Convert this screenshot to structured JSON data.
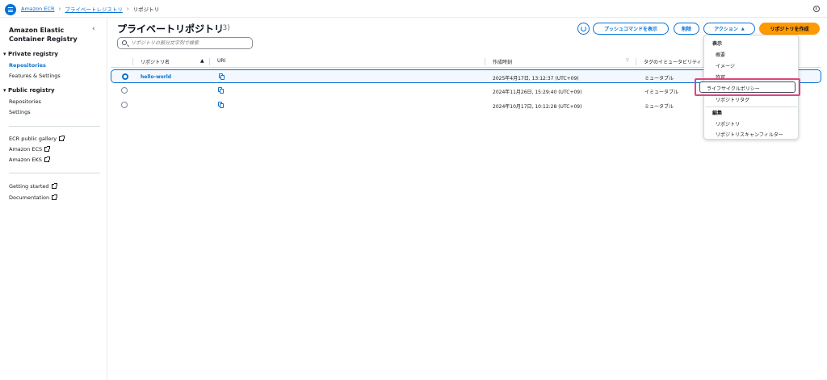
{
  "breadcrumb": {
    "root": "Amazon ECR",
    "parent": "プライベートレジストリ",
    "current": "リポジトリ"
  },
  "sidebar": {
    "title": "Amazon Elastic Container Registry",
    "private_section": "Private registry",
    "private_items": [
      "Repositories",
      "Features & Settings"
    ],
    "public_section": "Public registry",
    "public_items": [
      "Repositories",
      "Settings"
    ],
    "links": [
      "ECR public gallery",
      "Amazon ECS",
      "Amazon EKS"
    ],
    "help_links": [
      "Getting started",
      "Documentation"
    ]
  },
  "main": {
    "title": "プライベートリポジトリ",
    "count": "(3)",
    "search_placeholder": "リポジトリの部分文字列で検索"
  },
  "toolbar": {
    "push_label": "プッシュコマンドを表示",
    "delete_label": "削除",
    "action_label": "アクション",
    "create_label": "リポジトリを作成"
  },
  "table": {
    "columns": [
      "リポジトリ名",
      "URI",
      "作成時刻",
      "タグのイミュータビリティ"
    ],
    "rows": [
      {
        "name": "hello-world",
        "created": "2025年4月17日, 13:12:37 (UTC+09)",
        "immutability": "ミュータブル",
        "selected": true
      },
      {
        "name": "",
        "created": "2024年11月26日, 15:29:40 (UTC+09)",
        "immutability": "イミュータブル",
        "selected": false
      },
      {
        "name": "",
        "created": "2024年10月17日, 10:12:28 (UTC+09)",
        "immutability": "ミュータブル",
        "selected": false
      }
    ]
  },
  "action_menu": {
    "view_group": "表示",
    "view_items": [
      "概要",
      "イメージ",
      "許可",
      "ライフサイクルポリシー",
      "リポジトリタグ"
    ],
    "edit_group": "編集",
    "edit_items": [
      "リポジトリ",
      "リポジトリスキャンフィルター"
    ],
    "highlighted_index": 3
  },
  "colors": {
    "accent": "#0972d3",
    "primary_button": "#ff9900",
    "highlight_box": "#e0457b"
  }
}
